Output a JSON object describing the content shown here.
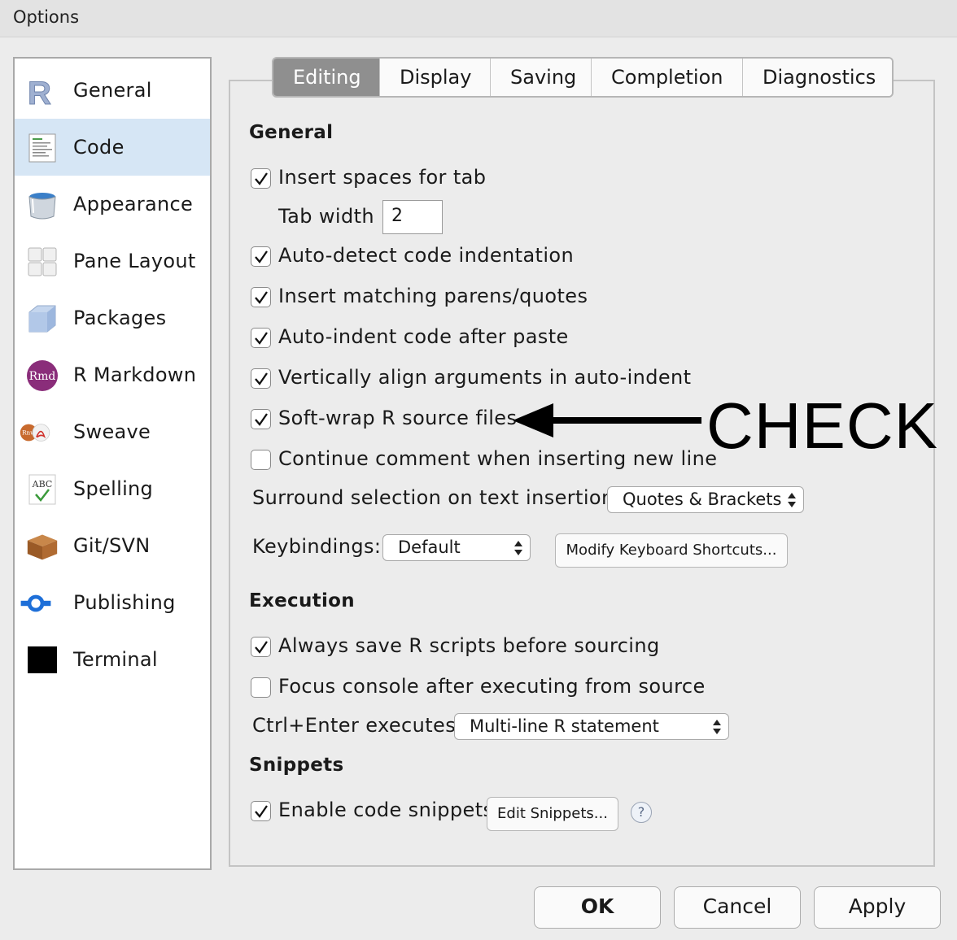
{
  "window": {
    "title": "Options"
  },
  "sidebar": {
    "items": [
      {
        "label": "General"
      },
      {
        "label": "Code"
      },
      {
        "label": "Appearance"
      },
      {
        "label": "Pane Layout"
      },
      {
        "label": "Packages"
      },
      {
        "label": "R Markdown"
      },
      {
        "label": "Sweave"
      },
      {
        "label": "Spelling"
      },
      {
        "label": "Git/SVN"
      },
      {
        "label": "Publishing"
      },
      {
        "label": "Terminal"
      }
    ],
    "active": "Code"
  },
  "tabs": [
    {
      "label": "Editing"
    },
    {
      "label": "Display"
    },
    {
      "label": "Saving"
    },
    {
      "label": "Completion"
    },
    {
      "label": "Diagnostics"
    }
  ],
  "active_tab": "Editing",
  "general": {
    "heading": "General",
    "insert_spaces": {
      "label": "Insert spaces for tab",
      "checked": true
    },
    "tab_width": {
      "label": "Tab width",
      "value": "2"
    },
    "auto_detect": {
      "label": "Auto-detect code indentation",
      "checked": true
    },
    "insert_matching": {
      "label": "Insert matching parens/quotes",
      "checked": true
    },
    "auto_indent": {
      "label": "Auto-indent code after paste",
      "checked": true
    },
    "vertical_align": {
      "label": "Vertically align arguments in auto-indent",
      "checked": true
    },
    "soft_wrap": {
      "label": "Soft-wrap R source files",
      "checked": true
    },
    "continue_comment": {
      "label": "Continue comment when inserting new line",
      "checked": false
    },
    "surround": {
      "label": "Surround selection on text insertion:",
      "value": "Quotes & Brackets"
    },
    "keybindings": {
      "label": "Keybindings:",
      "value": "Default"
    },
    "modify_shortcuts_label": "Modify Keyboard Shortcuts..."
  },
  "execution": {
    "heading": "Execution",
    "always_save": {
      "label": "Always save R scripts before sourcing",
      "checked": true
    },
    "focus_console": {
      "label": "Focus console after executing from source",
      "checked": false
    },
    "ctrl_enter": {
      "label": "Ctrl+Enter executes:",
      "value": "Multi-line R statement"
    }
  },
  "snippets": {
    "heading": "Snippets",
    "enable": {
      "label": "Enable code snippets",
      "checked": true
    },
    "edit_label": "Edit Snippets...",
    "help_glyph": "?"
  },
  "annotation": {
    "text": "CHECK"
  },
  "footer": {
    "ok_label": "OK",
    "cancel_label": "Cancel",
    "apply_label": "Apply"
  }
}
